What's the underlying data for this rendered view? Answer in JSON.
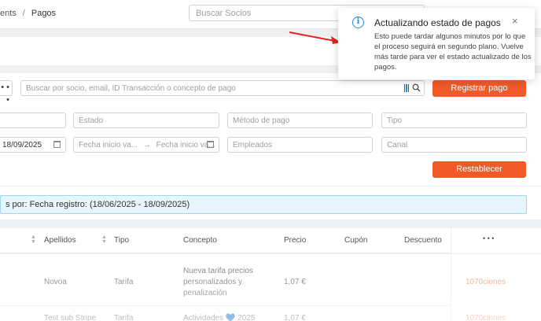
{
  "header": {
    "breadcrumb_prev": "ents",
    "breadcrumb_sep": "/",
    "breadcrumb_current": "Pagos",
    "search_placeholder": "Buscar Socios"
  },
  "filters": {
    "more_label": "• • •",
    "search_placeholder": "Buscar por socio, email, ID Transacción o concepto de pago",
    "register_label": "Registrar pago",
    "estado_placeholder": "Estado",
    "metodo_placeholder": "Método de pago",
    "tipo_placeholder": "Tipo",
    "date_value": "18/09/2025",
    "fecha_inicio_1": "Fecha inicio va...",
    "fecha_arrow": "→",
    "fecha_inicio_2": "Fecha inicio va...",
    "empleados_placeholder": "Empleados",
    "canal_placeholder": "Canal",
    "reset_label": "Restablecer",
    "filter_note": "s por: Fecha registro: (18/06/2025 - 18/09/2025)"
  },
  "table": {
    "headers": [
      "Apellidos",
      "Tipo",
      "Concepto",
      "Precio",
      "Cupón",
      "Descuento"
    ],
    "more_label": "• • •",
    "rows": [
      {
        "apellidos": "Novoa",
        "tipo": "Tarifa",
        "concepto": [
          "Nueva tarifa precios",
          "personalizados y",
          "penalización"
        ],
        "precio": "1,07 €",
        "opciones": "1070ciones"
      },
      {
        "apellidos": "Test sub Stripe",
        "tipo": "Tarifa",
        "concepto": [
          "Actividades 💙 2025"
        ],
        "precio": "1,07 €",
        "opciones": "1070ciones"
      }
    ]
  },
  "toast": {
    "icon": "info-icon",
    "title": "Actualizando estado de pagos",
    "close": "×",
    "body": "Esto puede tardar algunos minutos por lo que el proceso seguirá en segundo plano. Vuelve más tarde para ver el estado actualizado de los pagos."
  },
  "colors": {
    "accent": "#f05a28",
    "info": "#1a8fd6",
    "annotation_arrow": "#e0261f"
  }
}
